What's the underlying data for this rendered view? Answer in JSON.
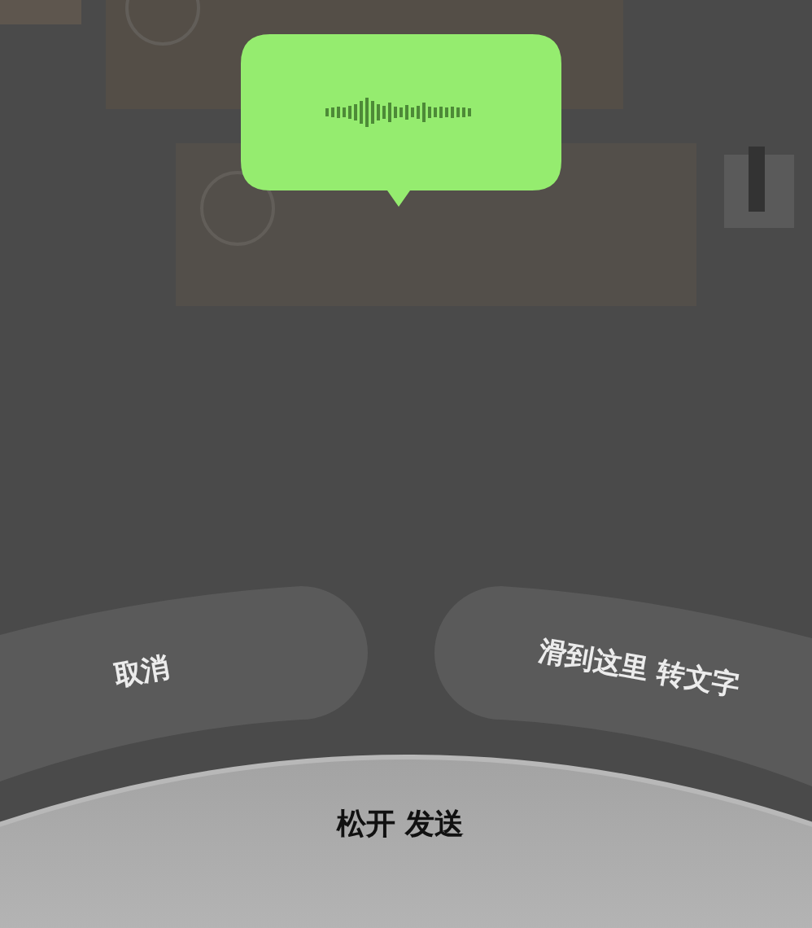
{
  "cancel_button": {
    "label": "取消"
  },
  "convert_button": {
    "label": "滑到这里 转文字"
  },
  "send_area": {
    "label": "松开 发送"
  }
}
